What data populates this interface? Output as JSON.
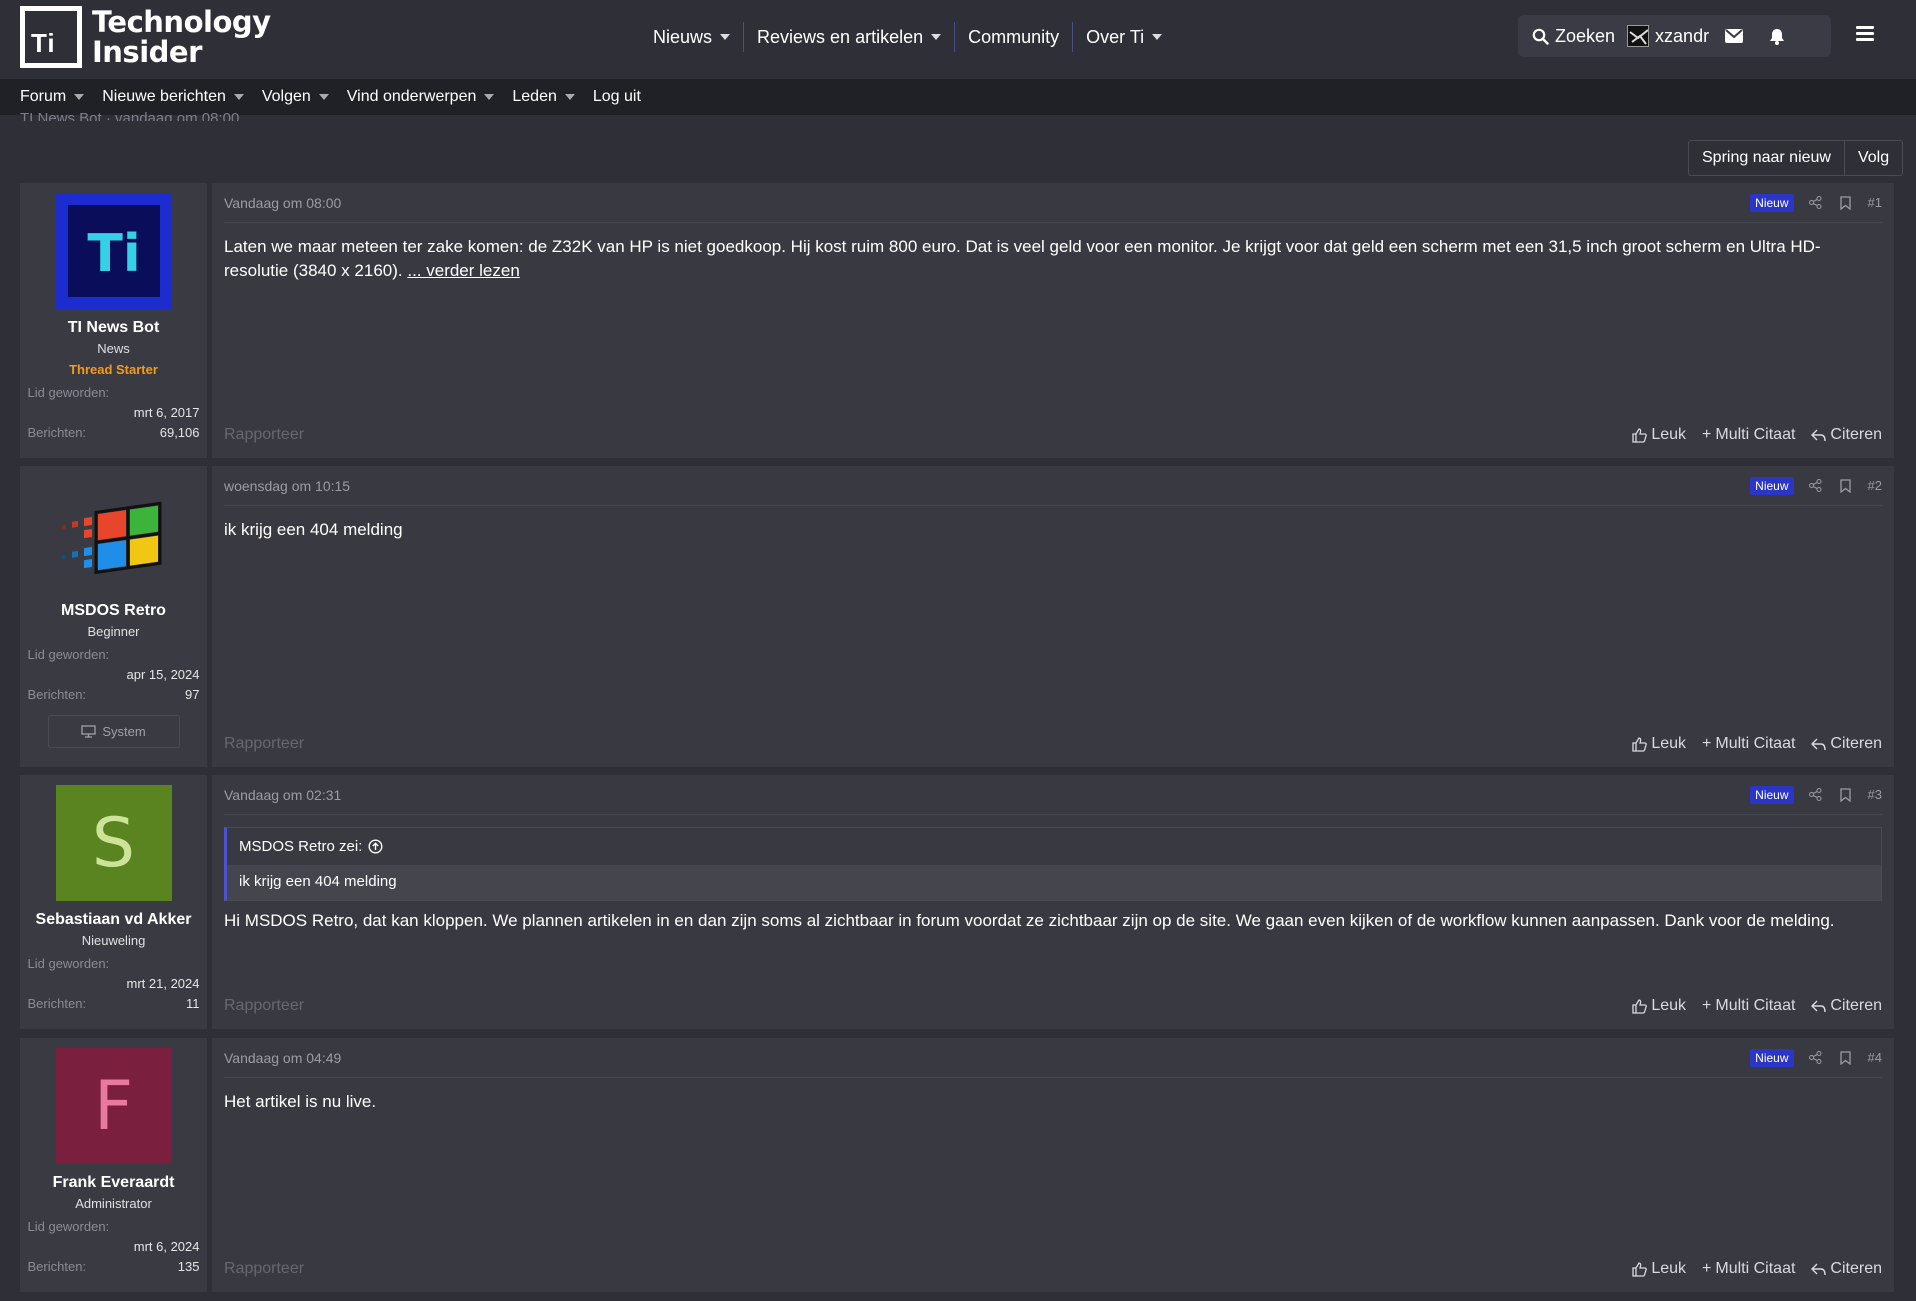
{
  "header": {
    "logo_text_line1": "Technology",
    "logo_text_line2": "Insider",
    "logo_mark": "Ti",
    "nav": [
      {
        "label": "Nieuws",
        "has_caret": true
      },
      {
        "label": "Reviews en artikelen",
        "has_caret": true
      },
      {
        "label": "Community",
        "has_caret": false
      },
      {
        "label": "Over Ti",
        "has_caret": true
      }
    ],
    "search_label": "Zoeken",
    "username": "xzandr"
  },
  "subnav": [
    {
      "label": "Forum"
    },
    {
      "label": "Nieuwe berichten"
    },
    {
      "label": "Volgen"
    },
    {
      "label": "Vind onderwerpen"
    },
    {
      "label": "Leden"
    },
    {
      "label": "Log uit"
    }
  ],
  "thread_meta": "TI News Bot · vandaag om 08:00",
  "thread_actions": {
    "jump_new": "Spring naar nieuw",
    "follow": "Volg"
  },
  "labels": {
    "joined": "Lid geworden:",
    "messages": "Berichten:",
    "new_badge": "Nieuw",
    "report": "Rapporteer",
    "like": "Leuk",
    "multi_quote": "Multi Citaat",
    "quote": "Citeren",
    "system": "System",
    "quote_said": "MSDOS Retro zei:"
  },
  "posts": [
    {
      "user": "TI News Bot",
      "title": "News",
      "banner": "Thread Starter",
      "joined": "mrt 6, 2017",
      "messages": "69,106",
      "date": "Vandaag om 08:00",
      "num": "#1",
      "body": "Laten we maar meteen ter zake komen: de Z32K van HP is niet goedkoop. Hij kost ruim 800 euro. Dat is veel geld voor een monitor. Je krijgt voor dat geld een scherm met een 31,5 inch groot scherm en Ultra HD-resolutie (3840 x 2160). ",
      "read_more": "... verder lezen"
    },
    {
      "user": "MSDOS Retro",
      "title": "Beginner",
      "joined": "apr 15, 2024",
      "messages": "97",
      "date": "woensdag om 10:15",
      "num": "#2",
      "body": "ik krijg een 404 melding"
    },
    {
      "user": "Sebastiaan vd Akker",
      "title": "Nieuweling",
      "avatar_letter": "S",
      "joined": "mrt 21, 2024",
      "messages": "11",
      "date": "Vandaag om 02:31",
      "num": "#3",
      "quote_text": "ik krijg een 404 melding",
      "body": "Hi MSDOS Retro, dat kan kloppen. We plannen artikelen in en dan zijn soms al zichtbaar in forum voordat ze zichtbaar zijn op de site. We gaan even kijken of de workflow kunnen aanpassen. Dank voor de melding."
    },
    {
      "user": "Frank Everaardt",
      "title": "Administrator",
      "avatar_letter": "F",
      "joined": "mrt 6, 2024",
      "messages": "135",
      "date": "Vandaag om 04:49",
      "num": "#4",
      "body": "Het artikel is nu live."
    }
  ],
  "colors": {
    "background": "#2f3037",
    "subnav": "#202126",
    "new_badge": "#2b35c6",
    "thread_starter": "#f39b1a",
    "avatar_s": "#5a8420",
    "avatar_f": "#7a1f3d"
  }
}
